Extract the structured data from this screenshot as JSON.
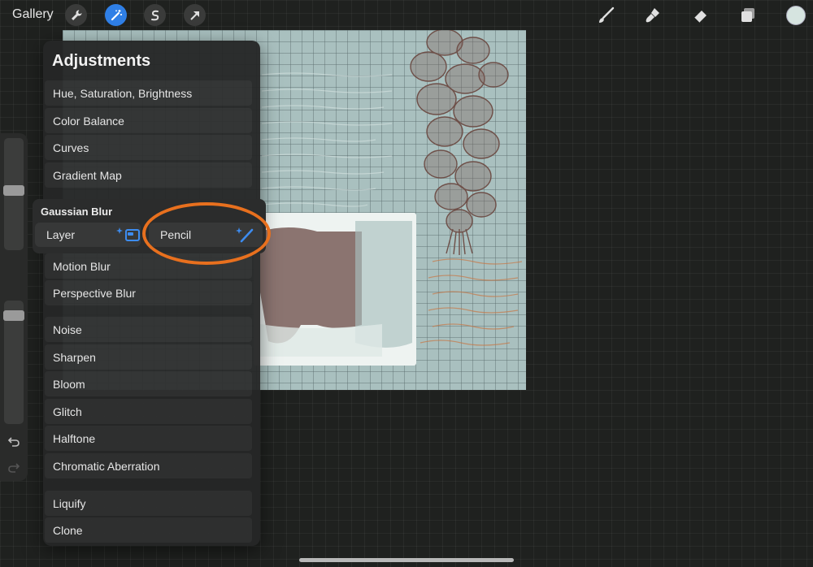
{
  "topbar": {
    "gallery_label": "Gallery",
    "left_tools": [
      "wrench-icon",
      "magic-wand-icon",
      "selection-icon",
      "transform-arrow-icon"
    ],
    "active_tool": "magic-wand-icon",
    "right_tools": [
      "brush-icon",
      "smudge-icon",
      "eraser-icon",
      "layers-icon"
    ],
    "current_color": "#d6e4e0"
  },
  "adjustments": {
    "title": "Adjustments",
    "group1": [
      "Hue, Saturation, Brightness",
      "Color Balance",
      "Curves",
      "Gradient Map"
    ],
    "gaussian_blur": {
      "title": "Gaussian Blur",
      "options": [
        "Layer",
        "Pencil"
      ],
      "highlighted": "Pencil"
    },
    "group2": [
      "Motion Blur",
      "Perspective Blur"
    ],
    "group3": [
      "Noise",
      "Sharpen",
      "Bloom",
      "Glitch",
      "Halftone",
      "Chromatic Aberration"
    ],
    "group4": [
      "Liquify",
      "Clone"
    ]
  },
  "colors": {
    "accent": "#2f7fe6",
    "highlight_ring": "#e8701e",
    "canvas_bg": "#a9c0bf",
    "ink": "#7a5a52"
  }
}
